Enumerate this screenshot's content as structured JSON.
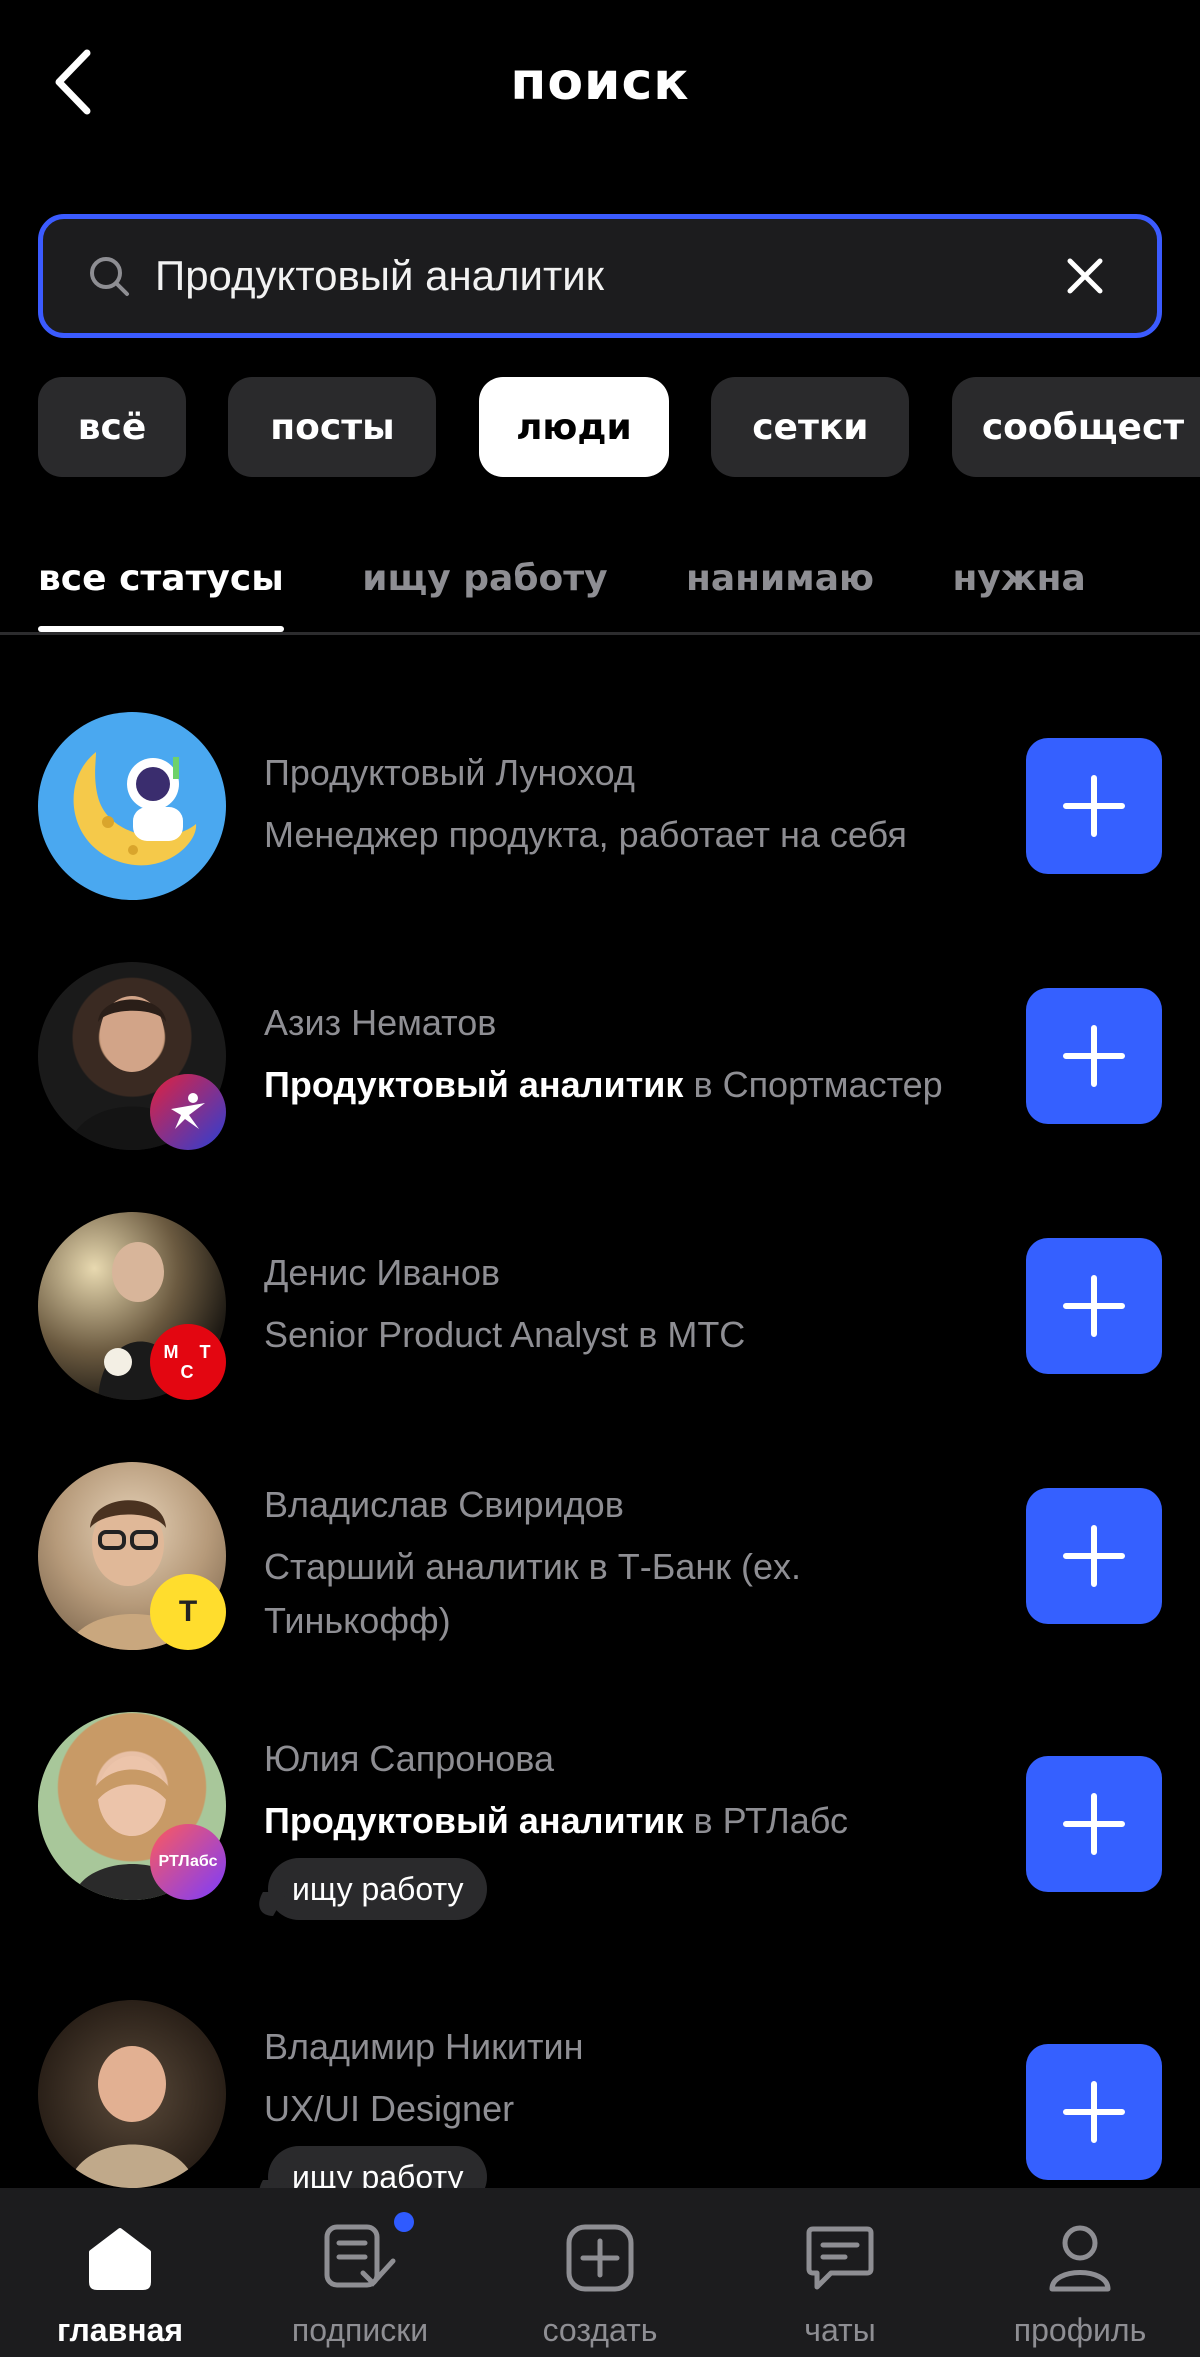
{
  "header": {
    "title": "поиск"
  },
  "search": {
    "value": "Продуктовый аналитик"
  },
  "chips": [
    {
      "label": "всё",
      "active": false
    },
    {
      "label": "посты",
      "active": false
    },
    {
      "label": "люди",
      "active": true
    },
    {
      "label": "сетки",
      "active": false
    },
    {
      "label": "сообщест",
      "active": false
    }
  ],
  "tabs": [
    {
      "label": "все статусы",
      "active": true
    },
    {
      "label": "ищу работу",
      "active": false
    },
    {
      "label": "нанимаю",
      "active": false
    },
    {
      "label": "нужна",
      "active": false
    }
  ],
  "people": [
    {
      "name": "Продуктовый Луноход",
      "role_plain": "Менеджер продукта, работает на себя",
      "avatar": "moon-astronaut-avatar"
    },
    {
      "name": "Азиз Нематов",
      "role_bold": "Продуктовый аналитик",
      "role_rest": " в Спортмастер",
      "badge": "sportmaster-logo"
    },
    {
      "name": "Денис Иванов",
      "role_plain": "Senior Product Analyst в МТС",
      "badge": "mts-logo",
      "badge_text": "М Т С"
    },
    {
      "name": "Владислав Свиридов",
      "role_plain": "Старший аналитик в Т-Банк (ex. Тинькофф)",
      "badge": "tbank-logo",
      "badge_text": "Т"
    },
    {
      "name": "Юлия Сапронова",
      "role_bold": "Продуктовый аналитик",
      "role_rest": " в РТЛабс",
      "badge": "rtlabs-logo",
      "badge_text": "РТЛабс",
      "status": "ищу работу"
    },
    {
      "name": "Владимир Никитин",
      "role_plain": "UX/UI Designer",
      "status": "ищу работу"
    }
  ],
  "nav": [
    {
      "label": "главная",
      "icon": "home-icon",
      "active": true
    },
    {
      "label": "подписки",
      "icon": "subscriptions-icon",
      "active": false,
      "dot": true
    },
    {
      "label": "создать",
      "icon": "create-icon",
      "active": false
    },
    {
      "label": "чаты",
      "icon": "chat-icon",
      "active": false
    },
    {
      "label": "профиль",
      "icon": "profile-icon",
      "active": false
    }
  ],
  "colors": {
    "accent": "#3560ff",
    "search_border": "#3b5bff",
    "background": "#000000",
    "chip_bg": "#2a2a2c"
  }
}
